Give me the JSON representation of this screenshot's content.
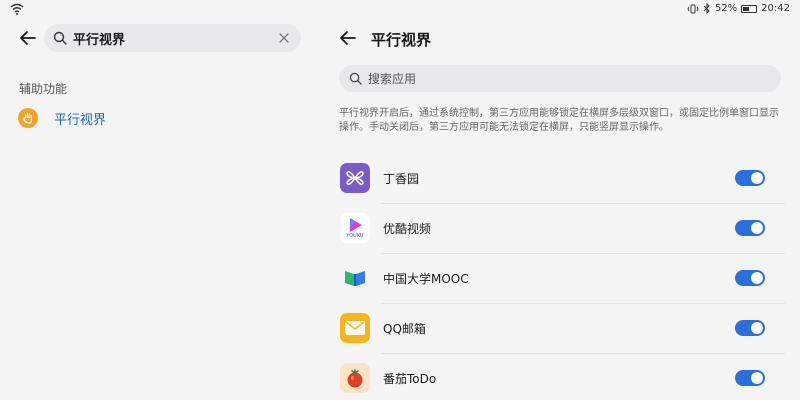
{
  "status": {
    "battery": "52%",
    "time": "20:42",
    "battery_level": 0.52
  },
  "left": {
    "search_value": "平行视界",
    "section_label": "辅助功能",
    "result_label": "平行视界"
  },
  "right": {
    "title": "平行视界",
    "search_placeholder": "搜索应用",
    "description": "平行视界开启后，通过系统控制，第三方应用能够锁定在横屏多层级双窗口，或固定比例单窗口显示操作。手动关闭后，第三方应用可能无法锁定在横屏，只能竖屏显示操作。",
    "apps": [
      {
        "name": "丁香园",
        "enabled": true,
        "icon": "dingxiangyuan-icon"
      },
      {
        "name": "优酷视频",
        "enabled": true,
        "icon": "youku-icon",
        "icon_text": "YOUKU"
      },
      {
        "name": "中国大学MOOC",
        "enabled": true,
        "icon": "mooc-icon"
      },
      {
        "name": "QQ邮箱",
        "enabled": true,
        "icon": "qqmail-icon"
      },
      {
        "name": "番茄ToDo",
        "enabled": true,
        "icon": "tomato-icon"
      }
    ]
  },
  "colors": {
    "accent": "#2a6fe0",
    "link": "#1d66d6",
    "orange": "#f4a22c"
  }
}
